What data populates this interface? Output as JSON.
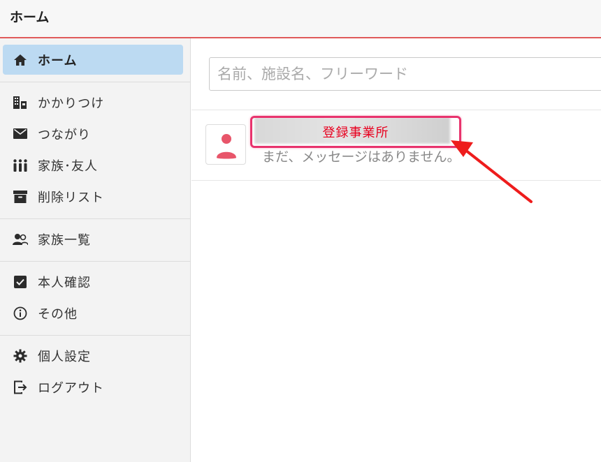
{
  "header": {
    "title": "ホーム"
  },
  "sidebar": {
    "items": [
      {
        "label": "ホーム",
        "icon": "home-icon",
        "active": true
      },
      {
        "label": "かかりつけ",
        "icon": "building-icon"
      },
      {
        "label": "つながり",
        "icon": "envelope-icon"
      },
      {
        "label": "家族･友人",
        "icon": "people-group-icon"
      },
      {
        "label": "削除リスト",
        "icon": "archive-icon"
      },
      {
        "label": "家族一覧",
        "icon": "users-icon"
      },
      {
        "label": "本人確認",
        "icon": "check-square-icon"
      },
      {
        "label": "その他",
        "icon": "info-circle-icon"
      },
      {
        "label": "個人設定",
        "icon": "gear-icon"
      },
      {
        "label": "ログアウト",
        "icon": "logout-icon"
      }
    ]
  },
  "main": {
    "search": {
      "placeholder": "名前、施設名、フリーワード"
    },
    "threads": [
      {
        "name_redacted": true,
        "preview": "まだ、メッセージはありません。"
      }
    ]
  },
  "annotation": {
    "label": "登録事業所"
  },
  "colors": {
    "active_item_bg": "#bcdaf2",
    "header_border": "#e05a5a",
    "avatar_color": "#e8556a",
    "highlight": "#e8336d",
    "arrow": "#ee1c1c"
  }
}
